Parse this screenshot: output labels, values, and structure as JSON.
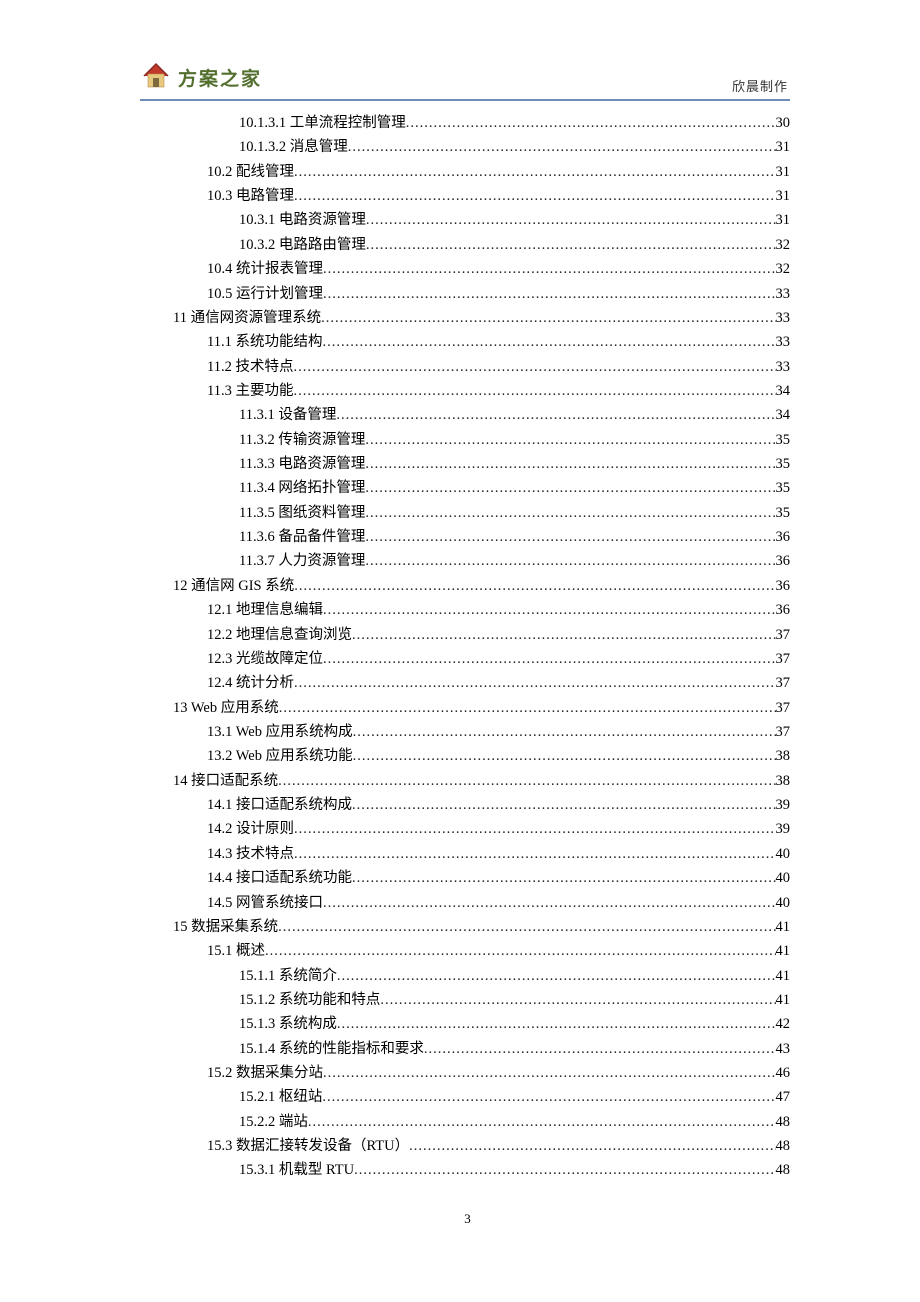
{
  "header": {
    "brand": "方案之家",
    "credit": "欣晨制作"
  },
  "footer": {
    "page_number": "3"
  },
  "toc": [
    {
      "lvl": 3,
      "title": "10.1.3.1  工单流程控制管理",
      "page": "30"
    },
    {
      "lvl": 3,
      "title": "10.1.3.2  消息管理",
      "page": "31"
    },
    {
      "lvl": 2,
      "title": "10.2  配线管理",
      "page": "31"
    },
    {
      "lvl": 2,
      "title": "10.3  电路管理",
      "page": "31"
    },
    {
      "lvl": 3,
      "title": "10.3.1  电路资源管理",
      "page": "31"
    },
    {
      "lvl": 3,
      "title": "10.3.2  电路路由管理",
      "page": "32"
    },
    {
      "lvl": 2,
      "title": "10.4  统计报表管理",
      "page": "32"
    },
    {
      "lvl": 2,
      "title": "10.5  运行计划管理",
      "page": "33"
    },
    {
      "lvl": 1,
      "title": "11  通信网资源管理系统",
      "page": "33"
    },
    {
      "lvl": 2,
      "title": "11.1  系统功能结构",
      "page": "33"
    },
    {
      "lvl": 2,
      "title": "11.2  技术特点",
      "page": "33"
    },
    {
      "lvl": 2,
      "title": "11.3  主要功能",
      "page": "34"
    },
    {
      "lvl": 3,
      "title": "11.3.1  设备管理",
      "page": "34"
    },
    {
      "lvl": 3,
      "title": "11.3.2  传输资源管理",
      "page": "35"
    },
    {
      "lvl": 3,
      "title": "11.3.3  电路资源管理",
      "page": "35"
    },
    {
      "lvl": 3,
      "title": "11.3.4  网络拓扑管理",
      "page": "35"
    },
    {
      "lvl": 3,
      "title": "11.3.5  图纸资料管理",
      "page": "35"
    },
    {
      "lvl": 3,
      "title": "11.3.6  备品备件管理",
      "page": "36"
    },
    {
      "lvl": 3,
      "title": "11.3.7  人力资源管理",
      "page": "36"
    },
    {
      "lvl": 1,
      "title": "12  通信网 GIS 系统",
      "page": "36"
    },
    {
      "lvl": 2,
      "title": "12.1  地理信息编辑",
      "page": "36"
    },
    {
      "lvl": 2,
      "title": "12.2  地理信息查询浏览",
      "page": "37"
    },
    {
      "lvl": 2,
      "title": "12.3  光缆故障定位",
      "page": "37"
    },
    {
      "lvl": 2,
      "title": "12.4  统计分析",
      "page": "37"
    },
    {
      "lvl": 1,
      "title": "13 Web 应用系统",
      "page": "37"
    },
    {
      "lvl": 2,
      "title": "13.1  Web 应用系统构成",
      "page": "37"
    },
    {
      "lvl": 2,
      "title": "13.2  Web 应用系统功能",
      "page": "38"
    },
    {
      "lvl": 1,
      "title": "14  接口适配系统",
      "page": "38"
    },
    {
      "lvl": 2,
      "title": "14.1  接口适配系统构成",
      "page": "39"
    },
    {
      "lvl": 2,
      "title": "14.2  设计原则",
      "page": "39"
    },
    {
      "lvl": 2,
      "title": "14.3  技术特点",
      "page": "40"
    },
    {
      "lvl": 2,
      "title": "14.4  接口适配系统功能",
      "page": "40"
    },
    {
      "lvl": 2,
      "title": "14.5  网管系统接口",
      "page": "40"
    },
    {
      "lvl": 1,
      "title": "15  数据采集系统",
      "page": "41"
    },
    {
      "lvl": 2,
      "title": "15.1 概述",
      "page": "41"
    },
    {
      "lvl": 3,
      "title": "15.1.1  系统简介",
      "page": "41"
    },
    {
      "lvl": 3,
      "title": "15.1.2  系统功能和特点",
      "page": "41"
    },
    {
      "lvl": 3,
      "title": "15.1.3  系统构成",
      "page": "42"
    },
    {
      "lvl": 3,
      "title": "15.1.4  系统的性能指标和要求",
      "page": "43"
    },
    {
      "lvl": 2,
      "title": "15.2 数据采集分站",
      "page": "46"
    },
    {
      "lvl": 3,
      "title": "15.2.1  枢纽站",
      "page": "47"
    },
    {
      "lvl": 3,
      "title": "15.2.2  端站",
      "page": "48"
    },
    {
      "lvl": 2,
      "title": "15.3 数据汇接转发设备（RTU）",
      "page": "48"
    },
    {
      "lvl": 3,
      "title": "15.3.1  机载型 RTU",
      "page": "48"
    }
  ]
}
